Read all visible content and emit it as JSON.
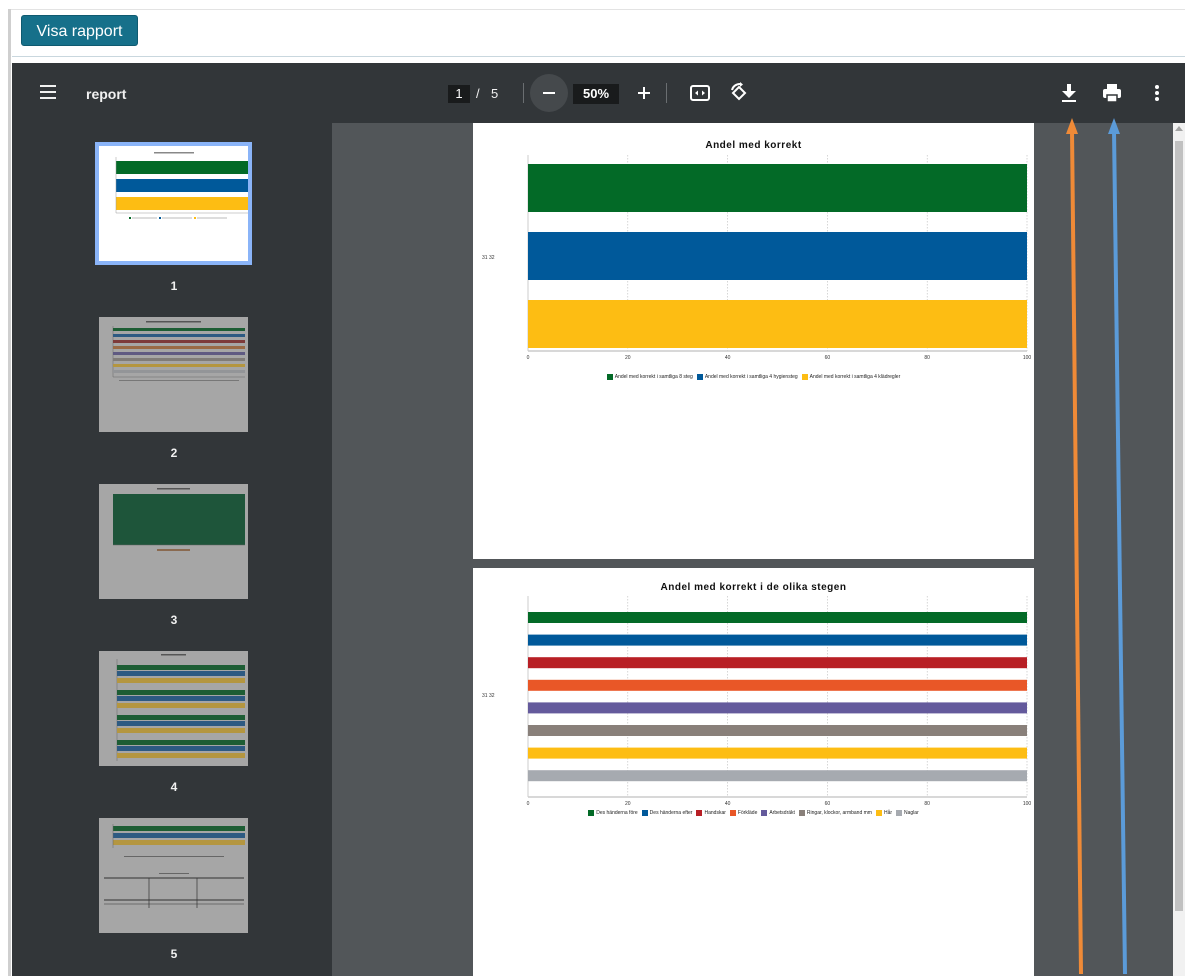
{
  "report_button": {
    "label": "Visa rapport"
  },
  "viewer": {
    "title": "report",
    "page_current": "1",
    "page_separator": "/",
    "page_total": "5",
    "zoom": "50%",
    "icons": [
      "menu-icon",
      "zoom-out-icon",
      "zoom-in-icon",
      "fit-page-icon",
      "rotate-icon",
      "download-icon",
      "print-icon",
      "more-icon"
    ]
  },
  "thumbnails": [
    {
      "number": "1",
      "title": "Andel med korrekt",
      "active": true
    },
    {
      "number": "2",
      "title": "Andel med korrekt i de olika stegen",
      "active": false
    },
    {
      "number": "3",
      "title": "Andel korrekta steg",
      "active": false
    },
    {
      "number": "4",
      "title": "Hygiensteg",
      "active": false
    },
    {
      "number": "5",
      "title": "Klädregler",
      "active": false
    }
  ],
  "pages": [
    {
      "y_label": "31 32",
      "chart_data": {
        "type": "bar",
        "orientation": "horizontal",
        "title": "Andel med korrekt",
        "categories": [
          "31 32"
        ],
        "x_ticks": [
          "0",
          "20",
          "40",
          "60",
          "80",
          "100"
        ],
        "xlim": [
          0,
          100
        ],
        "grid": true,
        "legend_position": "bottom",
        "series": [
          {
            "name": "Andel med korrekt i samtliga 8 steg",
            "color": "#036a27",
            "values": [
              100
            ]
          },
          {
            "name": "Andel med korrekt i samtliga 4 hygiensteg",
            "color": "#00599a",
            "values": [
              100
            ]
          },
          {
            "name": "Andel med korrekt i samtliga 4 klädregler",
            "color": "#fdbd13",
            "values": [
              100
            ]
          }
        ]
      }
    },
    {
      "y_label": "31 32",
      "chart_data": {
        "type": "bar",
        "orientation": "horizontal",
        "title": "Andel med korrekt i de olika stegen",
        "categories": [
          "31 32"
        ],
        "x_ticks": [
          "0",
          "20",
          "40",
          "60",
          "80",
          "100"
        ],
        "xlim": [
          0,
          100
        ],
        "grid": true,
        "legend_position": "bottom",
        "series": [
          {
            "name": "Des händerna före",
            "color": "#036a27",
            "values": [
              100
            ]
          },
          {
            "name": "Des händerna efter",
            "color": "#00599a",
            "values": [
              100
            ]
          },
          {
            "name": "Handskar",
            "color": "#b81f25",
            "values": [
              100
            ]
          },
          {
            "name": "Förkläde",
            "color": "#e95727",
            "values": [
              100
            ]
          },
          {
            "name": "Arbetsdräkt",
            "color": "#645a9c",
            "values": [
              100
            ]
          },
          {
            "name": "Ringar, klockor, armband mm",
            "color": "#89807a",
            "values": [
              100
            ]
          },
          {
            "name": "Hår",
            "color": "#fdbd13",
            "values": [
              100
            ]
          },
          {
            "name": "Naglar",
            "color": "#a6aab0",
            "values": [
              100
            ]
          }
        ]
      }
    }
  ],
  "colors": {
    "toolbar": "#323639",
    "background": "#525659",
    "button": "#16708a",
    "thumb_highlight": "#8ab4f8"
  }
}
